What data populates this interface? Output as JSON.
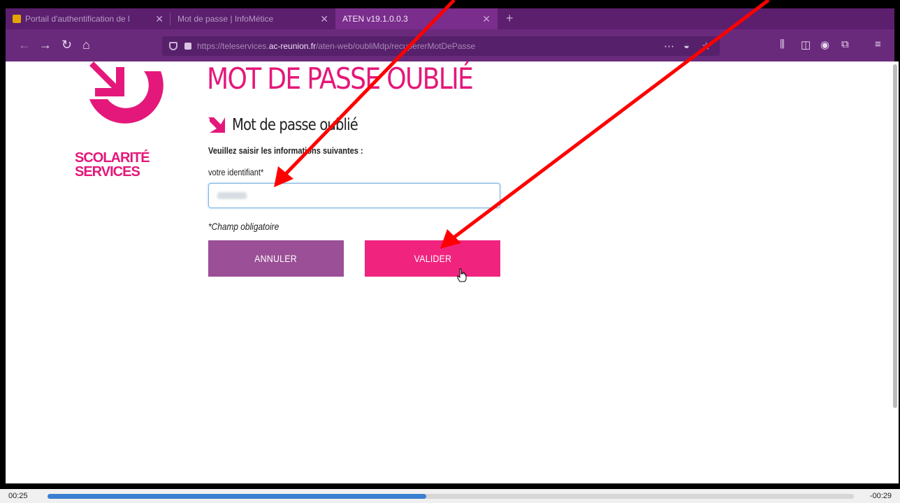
{
  "browser": {
    "tabs": [
      {
        "label": "Portail d'authentification de l",
        "active": false
      },
      {
        "label": "Mot de passe | InfoMétice",
        "active": false
      },
      {
        "label": "ATEN v19.1.0.0.3",
        "active": true
      }
    ],
    "url_prefix": "https://teleservices.",
    "url_domain": "ac-reunion.fr",
    "url_path": "/aten-web/oubliMdp/recupererMotDePasse"
  },
  "logo": {
    "line1": "SCOLARITÉ",
    "line2": "SERVICES",
    "color": "#e4187a"
  },
  "form": {
    "page_title": "MOT DE PASSE OUBLIÉ",
    "section_title": "Mot de passe oublié",
    "intro": "Veuillez saisir les informations suivantes :",
    "identifier_label": "votre identifiant*",
    "required_note": "*Champ obligatoire",
    "cancel_label": "ANNULER",
    "submit_label": "VALIDER"
  },
  "video": {
    "elapsed": "00:25",
    "remaining": "-00:29",
    "progress_fraction": 0.47
  }
}
